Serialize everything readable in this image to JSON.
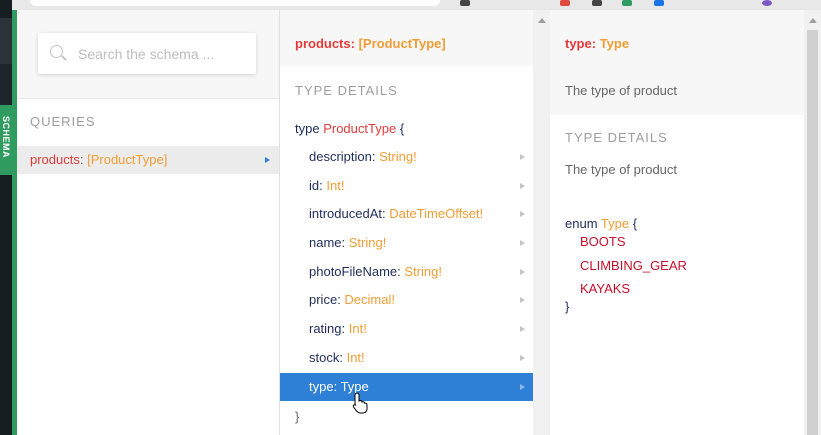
{
  "colors": {
    "accent_green": "#2f9b5e",
    "field_name_navy": "#1f2d5c",
    "field_name_red": "#e33b3b",
    "type_orange": "#f29d35",
    "enum_red": "#c4102a",
    "selected_blue": "#2e80d7"
  },
  "sidebar": {
    "schema_tab_label": "SCHEMA"
  },
  "search": {
    "placeholder": "Search the schema ..."
  },
  "queries": {
    "heading": "QUERIES",
    "items": [
      {
        "name": "products",
        "type": "[ProductType]"
      }
    ]
  },
  "product_panel": {
    "header": {
      "name": "products",
      "type": "[ProductType]"
    },
    "section_title": "TYPE DETAILS",
    "type_keyword": "type",
    "type_name": "ProductType",
    "open_brace": "{",
    "close_brace": "}",
    "fields": [
      {
        "name": "description",
        "type": "String!"
      },
      {
        "name": "id",
        "type": "Int!"
      },
      {
        "name": "introducedAt",
        "type": "DateTimeOffset!"
      },
      {
        "name": "name",
        "type": "String!"
      },
      {
        "name": "photoFileName",
        "type": "String!"
      },
      {
        "name": "price",
        "type": "Decimal!"
      },
      {
        "name": "rating",
        "type": "Int!"
      },
      {
        "name": "stock",
        "type": "Int!"
      },
      {
        "name": "type",
        "type": "Type",
        "selected": true
      }
    ]
  },
  "type_panel": {
    "header": {
      "name": "type",
      "type": "Type"
    },
    "description": "The type of product",
    "section_title": "TYPE DETAILS",
    "details_description": "The type of product",
    "enum_keyword": "enum",
    "enum_name": "Type",
    "open_brace": "{",
    "close_brace": "}",
    "values": [
      "BOOTS",
      "CLIMBING_GEAR",
      "KAYAKS"
    ]
  }
}
